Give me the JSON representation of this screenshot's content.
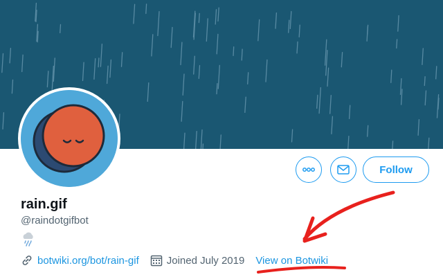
{
  "profile": {
    "display_name": "rain.gif",
    "handle": "@raindotgifbot",
    "bio_emoji": "cloud-with-rain",
    "website": "botwiki.org/bot/rain-gif",
    "joined": "Joined July 2019",
    "extra_link": "View on Botwiki"
  },
  "actions": {
    "more_icon": "ellipsis-icon",
    "message_icon": "envelope-icon",
    "follow_label": "Follow"
  },
  "colors": {
    "banner": "#1a5772",
    "rain": "#6d9bb3",
    "accent": "#1d9bf0",
    "avatar_bg": "#4fa8d9",
    "avatar_moon": "#e0603e",
    "annotation": "#e8211d"
  }
}
